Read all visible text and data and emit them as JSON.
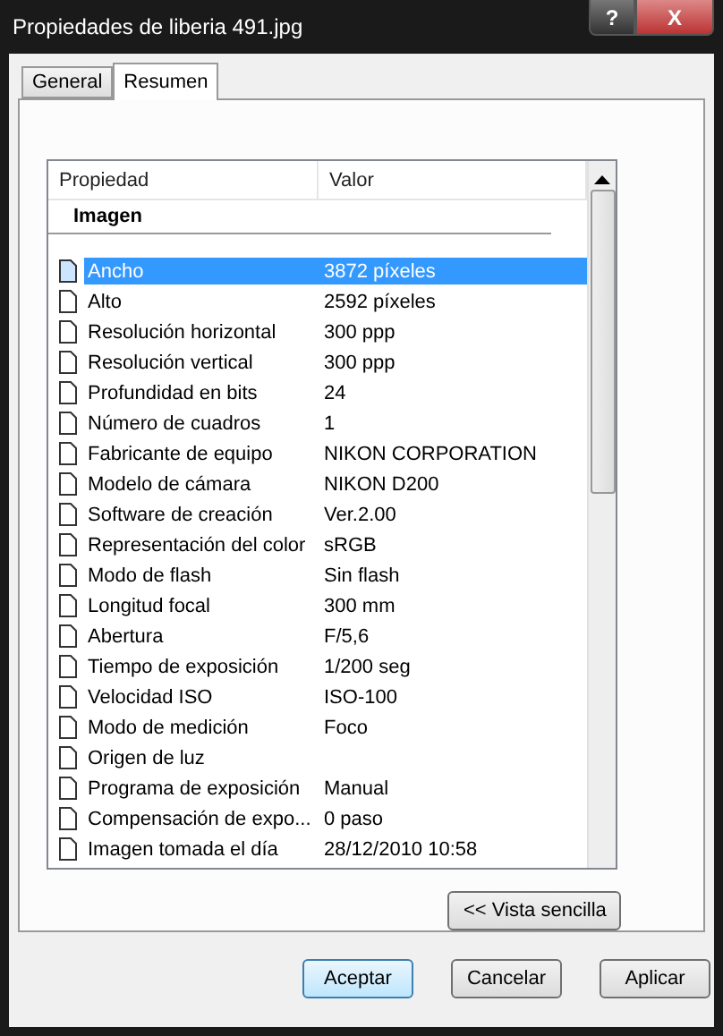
{
  "window": {
    "title": "Propiedades de liberia 491.jpg",
    "help": "?",
    "close": "X"
  },
  "tabs": [
    {
      "label": "General",
      "selected": false
    },
    {
      "label": "Resumen",
      "selected": true
    }
  ],
  "table": {
    "columns": [
      "Propiedad",
      "Valor"
    ],
    "group": "Imagen",
    "rows": [
      {
        "property": "Ancho",
        "value": "3872 píxeles",
        "selected": true
      },
      {
        "property": "Alto",
        "value": "2592 píxeles",
        "selected": false
      },
      {
        "property": "Resolución horizontal",
        "value": "300 ppp",
        "selected": false
      },
      {
        "property": "Resolución vertical",
        "value": "300 ppp",
        "selected": false
      },
      {
        "property": "Profundidad en bits",
        "value": "24",
        "selected": false
      },
      {
        "property": "Número de cuadros",
        "value": "1",
        "selected": false
      },
      {
        "property": "Fabricante de equipo",
        "value": "NIKON CORPORATION",
        "selected": false
      },
      {
        "property": "Modelo de cámara",
        "value": "NIKON D200",
        "selected": false
      },
      {
        "property": "Software de creación",
        "value": "Ver.2.00",
        "selected": false
      },
      {
        "property": "Representación del color",
        "value": "sRGB",
        "selected": false
      },
      {
        "property": "Modo de flash",
        "value": "Sin flash",
        "selected": false
      },
      {
        "property": "Longitud focal",
        "value": "300 mm",
        "selected": false
      },
      {
        "property": "Abertura",
        "value": "F/5,6",
        "selected": false
      },
      {
        "property": "Tiempo de exposición",
        "value": "1/200 seg",
        "selected": false
      },
      {
        "property": "Velocidad ISO",
        "value": "ISO-100",
        "selected": false
      },
      {
        "property": "Modo de medición",
        "value": "Foco",
        "selected": false
      },
      {
        "property": "Origen de luz",
        "value": "",
        "selected": false
      },
      {
        "property": "Programa de exposición",
        "value": "Manual",
        "selected": false
      },
      {
        "property": "Compensación de expo...",
        "value": "0 paso",
        "selected": false
      },
      {
        "property": "Imagen tomada el día",
        "value": "28/12/2010 10:58",
        "selected": false
      }
    ]
  },
  "view_button": "<< Vista sencilla",
  "buttons": [
    {
      "label": "Aceptar",
      "default": true
    },
    {
      "label": "Cancelar",
      "default": false
    },
    {
      "label": "Aplicar",
      "default": false
    }
  ]
}
